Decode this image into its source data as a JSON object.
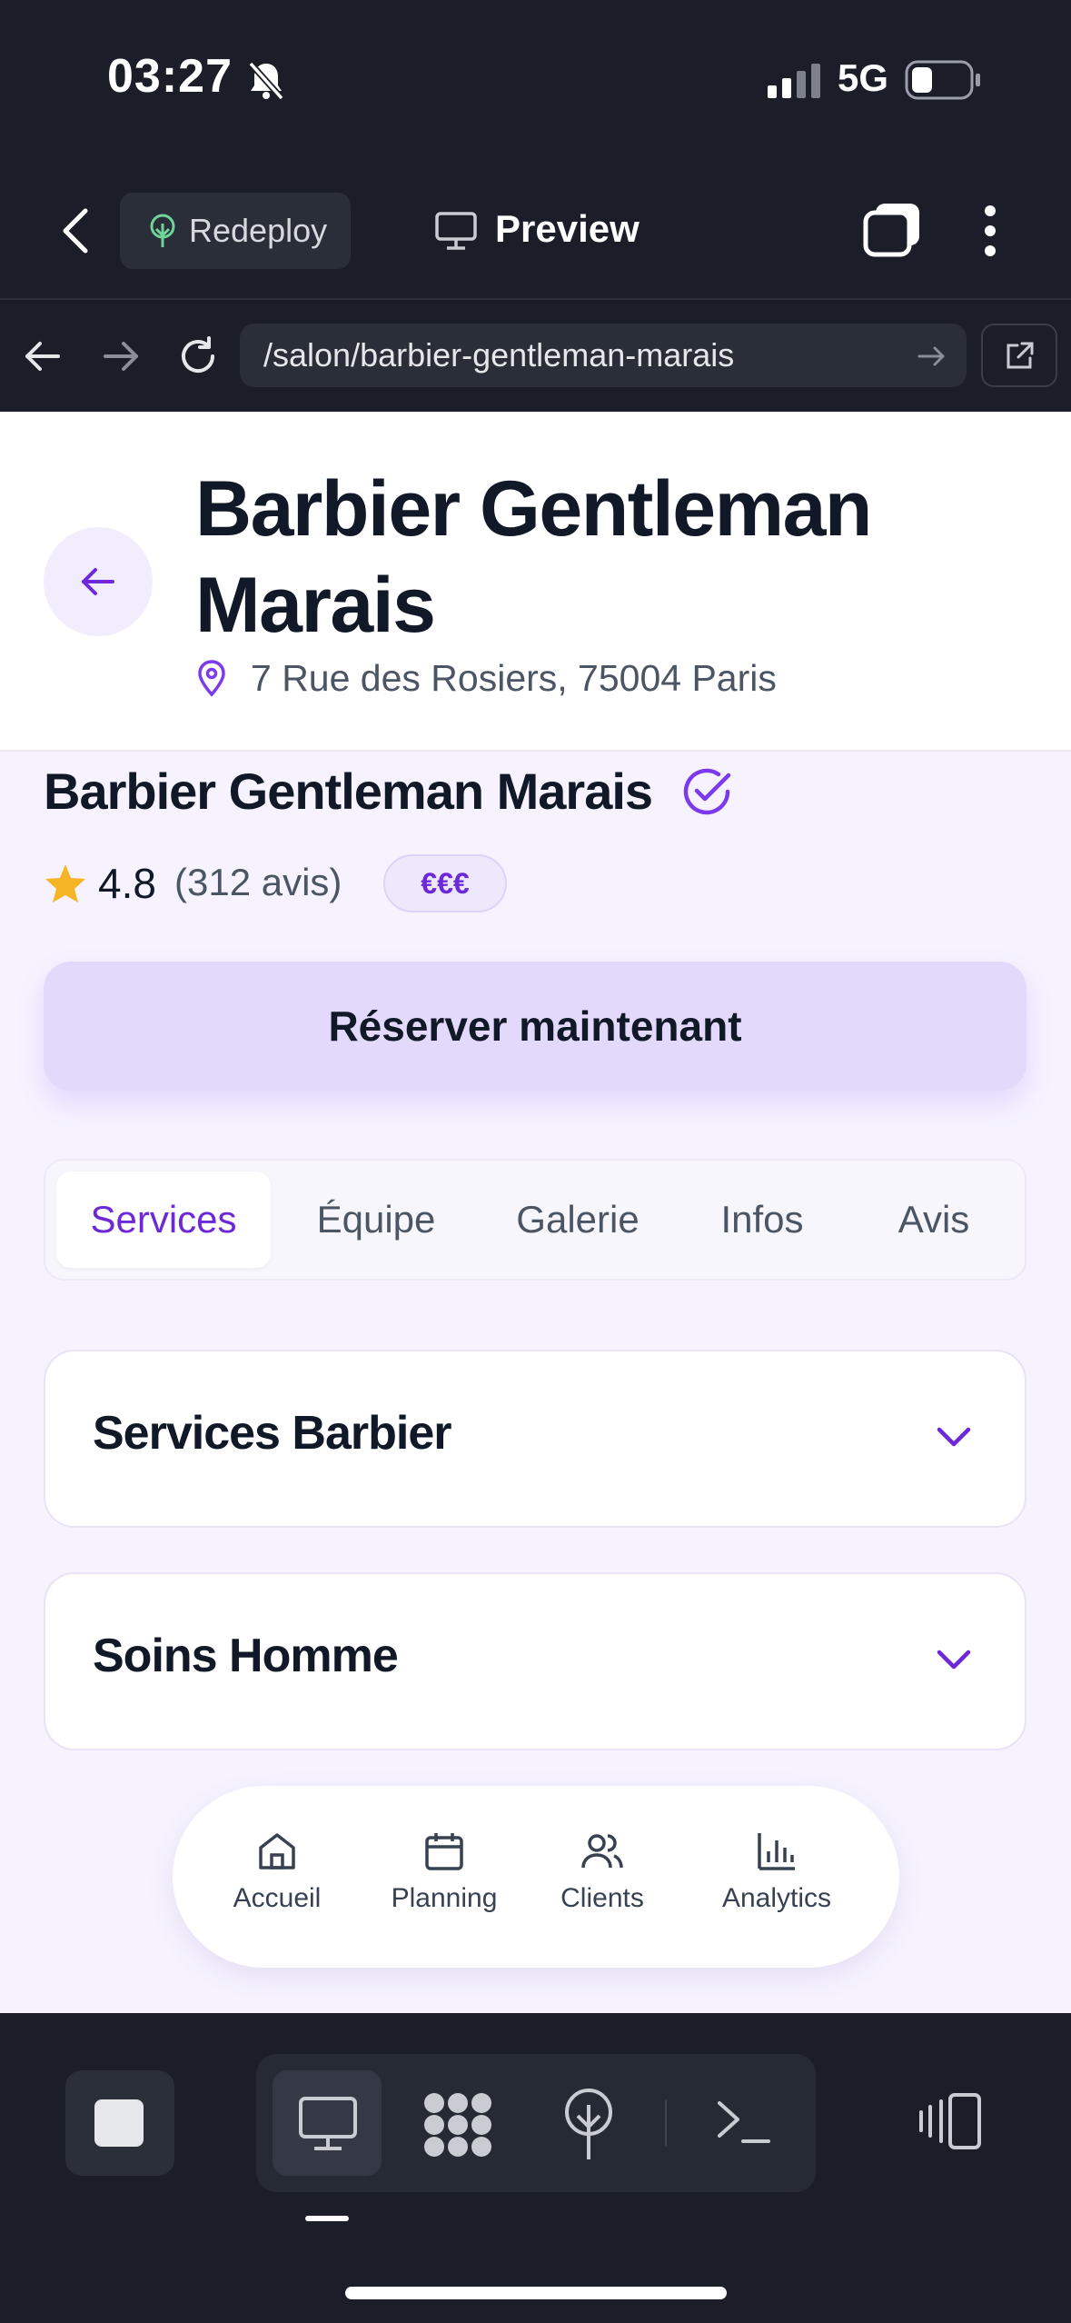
{
  "status": {
    "time": "03:27",
    "network": "5G"
  },
  "topbar": {
    "redeploy": "Redeploy",
    "preview": "Preview"
  },
  "browser": {
    "url": "/salon/barbier-gentleman-marais"
  },
  "header": {
    "title": "Barbier Gentleman Marais",
    "address": "7 Rue des Rosiers, 75004 Paris"
  },
  "salon": {
    "name": "Barbier Gentleman Marais",
    "rating": "4.8",
    "reviews": "(312 avis)",
    "price": "€€€"
  },
  "book_button": "Réserver maintenant",
  "tabs": [
    {
      "label": "Services",
      "active": true
    },
    {
      "label": "Équipe"
    },
    {
      "label": "Galerie"
    },
    {
      "label": "Infos"
    },
    {
      "label": "Avis"
    }
  ],
  "sections": [
    {
      "title": "Services Barbier"
    },
    {
      "title": "Soins Homme"
    }
  ],
  "bottom_nav": [
    {
      "label": "Accueil",
      "icon": "home-icon"
    },
    {
      "label": "Planning",
      "icon": "calendar-icon"
    },
    {
      "label": "Clients",
      "icon": "users-icon"
    },
    {
      "label": "Analytics",
      "icon": "bar-chart-icon"
    }
  ],
  "colors": {
    "accent": "#6d28d9",
    "dark_bg": "#1b1e28",
    "page_bg": "#f6f3ff",
    "star": "#f5b524"
  }
}
